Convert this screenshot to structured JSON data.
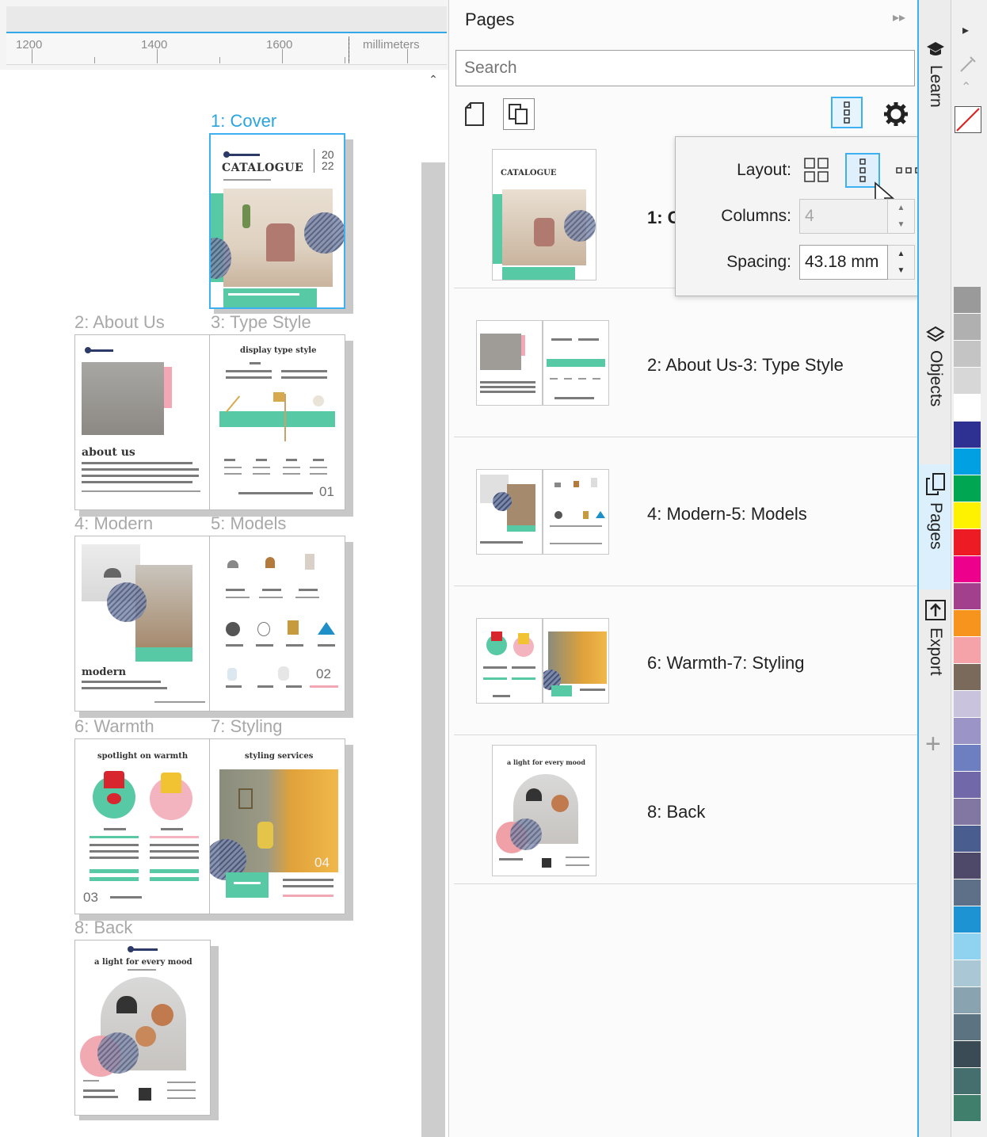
{
  "ruler": {
    "labels": [
      "1200",
      "1400",
      "1600",
      "millimeters"
    ]
  },
  "canvas": {
    "pages": [
      {
        "label": "1: Cover"
      },
      {
        "label": "2: About Us"
      },
      {
        "label": "3: Type Style"
      },
      {
        "label": "4: Modern"
      },
      {
        "label": "5: Models"
      },
      {
        "label": "6: Warmth"
      },
      {
        "label": "7: Styling"
      },
      {
        "label": "8: Back"
      }
    ],
    "cover_title": "CATALOGUE",
    "cover_year_top": "20",
    "cover_year_bottom": "22",
    "about_heading": "about us",
    "type_heading": "display type style",
    "modern_heading": "modern",
    "warmth_heading": "spotlight on warmth",
    "styling_heading": "styling services",
    "back_heading": "a light for every mood",
    "page_numbers": [
      "01",
      "02",
      "03",
      "04"
    ]
  },
  "docker": {
    "title": "Pages",
    "search_placeholder": "Search",
    "rows": [
      {
        "label": "1: C"
      },
      {
        "label": "2: About Us-3: Type Style"
      },
      {
        "label": "4: Modern-5: Models"
      },
      {
        "label": "6: Warmth-7: Styling"
      },
      {
        "label": "8: Back"
      }
    ]
  },
  "layout_popup": {
    "layout_label": "Layout:",
    "columns_label": "Columns:",
    "columns_value": "4",
    "spacing_label": "Spacing:",
    "spacing_value": "43.18 mm",
    "selected_layout": "vertical-list"
  },
  "tabs": [
    {
      "label": "Learn",
      "icon": "graduation-cap-icon"
    },
    {
      "label": "Objects",
      "icon": "layers-icon"
    },
    {
      "label": "Pages",
      "icon": "pages-icon"
    },
    {
      "label": "Export",
      "icon": "export-icon"
    }
  ],
  "palette": [
    "#9a9a9a",
    "#b0b0b0",
    "#c4c4c4",
    "#d7d7d7",
    "#ffffff",
    "#2e3192",
    "#00a0e3",
    "#00a651",
    "#fff200",
    "#ed1c24",
    "#ec008c",
    "#a3408e",
    "#f7941d",
    "#f5a3a9",
    "#7a6a5c",
    "#c9c3dd",
    "#9b94c6",
    "#6d7fc0",
    "#7068a9",
    "#8177a2",
    "#4a5d8f",
    "#4e4869",
    "#5d7088",
    "#1e93d3",
    "#8fd3f0",
    "#aac7d6",
    "#8aa3b0",
    "#5c7381",
    "#3b4b55",
    "#456e6e",
    "#3f7f6b"
  ]
}
